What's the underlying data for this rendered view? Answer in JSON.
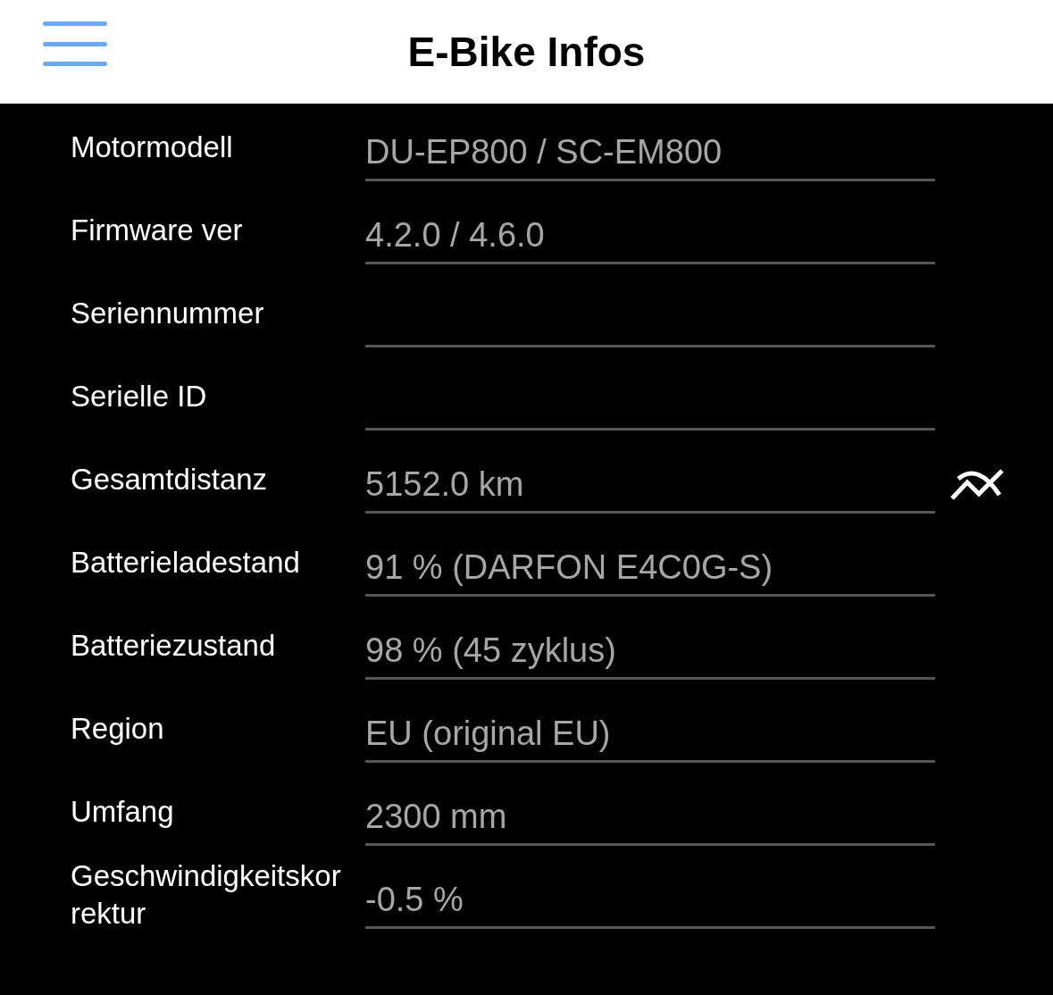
{
  "header": {
    "title": "E-Bike Infos"
  },
  "rows": [
    {
      "label": "Motormodell",
      "value": "DU-EP800 / SC-EM800"
    },
    {
      "label": "Firmware ver",
      "value": "4.2.0 / 4.6.0"
    },
    {
      "label": "Seriennummer",
      "redacted": true
    },
    {
      "label": "Serielle ID",
      "redacted": true
    },
    {
      "label": "Gesamtdistanz",
      "value": "5152.0 km",
      "chart_button": true
    },
    {
      "label": "Batterieladestand",
      "value": "91 % (DARFON E4C0G-S)"
    },
    {
      "label": "Batteriezustand",
      "value": "98 % (45 zyklus)"
    },
    {
      "label": "Region",
      "value": "EU (original EU)"
    },
    {
      "label": "Umfang",
      "value": "2300 mm"
    },
    {
      "label": "Geschwindigkeitskorrektur",
      "value": "-0.5 %"
    }
  ]
}
